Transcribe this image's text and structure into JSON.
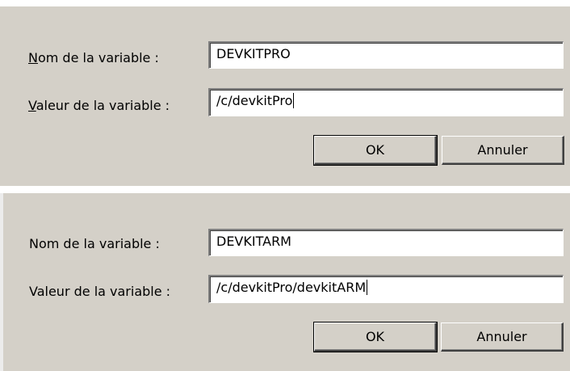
{
  "dialogs": [
    {
      "name_label": "Nom de la variable :",
      "value_label": "Valeur de la variable :",
      "name_value": "DEVKITPRO",
      "value_value": "/c/devkitPro",
      "ok_label": "OK",
      "cancel_label": "Annuler"
    },
    {
      "name_label": "Nom de la variable :",
      "value_label": "Valeur de la variable :",
      "name_value": "DEVKITARM",
      "value_value": "/c/devkitPro/devkitARM",
      "ok_label": "OK",
      "cancel_label": "Annuler"
    }
  ]
}
